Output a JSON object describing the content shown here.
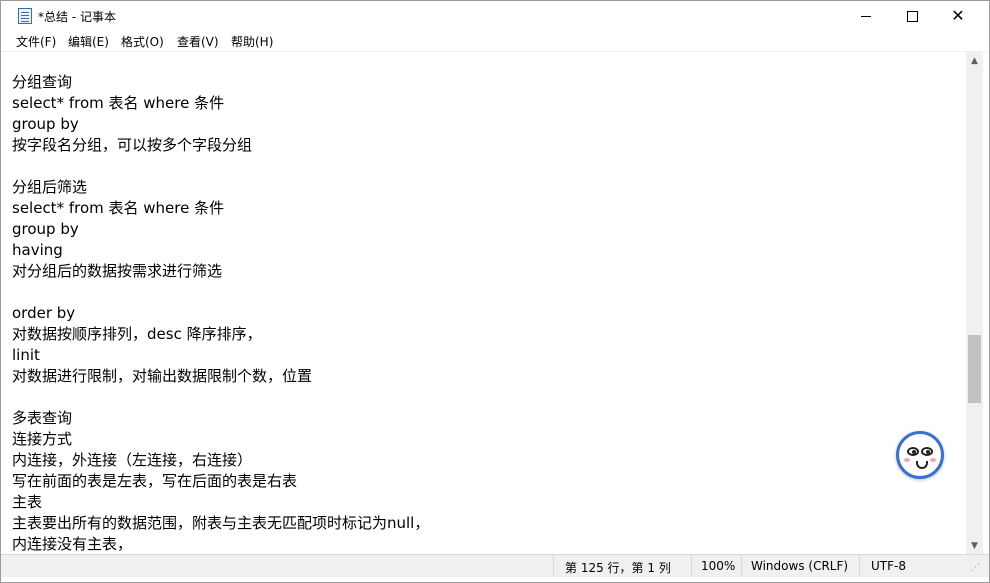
{
  "window": {
    "title": "*总结 - 记事本"
  },
  "menu": [
    {
      "label": "文件(F)"
    },
    {
      "label": "编辑(E)"
    },
    {
      "label": "格式(O)"
    },
    {
      "label": "查看(V)"
    },
    {
      "label": "帮助(H)"
    }
  ],
  "editor": {
    "lines": [
      "分组查询",
      "select* from 表名 where 条件",
      "group by",
      "按字段名分组，可以按多个字段分组",
      "",
      "分组后筛选",
      "select* from 表名 where 条件",
      "group by",
      "having",
      "对分组后的数据按需求进行筛选",
      "",
      "order by",
      "对数据按顺序排列，desc 降序排序，",
      "linit",
      "对数据进行限制，对输出数据限制个数，位置",
      "",
      "多表查询",
      "连接方式",
      "内连接，外连接（左连接，右连接）",
      "写在前面的表是左表，写在后面的表是右表",
      "主表",
      "主表要出所有的数据范围，附表与主表无匹配项时标记为null，",
      "内连接没有主表，"
    ]
  },
  "statusbar": {
    "position": "第 125 行，第 1 列",
    "zoom": "100%",
    "line_ending": "Windows (CRLF)",
    "encoding": "UTF-8"
  },
  "scrollbar": {
    "position_fraction": 0.6
  },
  "icons": {
    "app": "notepad-icon",
    "minimize": "minimize-icon",
    "maximize": "maximize-icon",
    "close": "close-icon",
    "scroll_up": "chevron-up-icon",
    "scroll_down": "chevron-down-icon",
    "floating": "assistant-face-icon"
  },
  "colors": {
    "floating_border": "#3a6fd6",
    "scroll_thumb": "#c2c2c2"
  }
}
